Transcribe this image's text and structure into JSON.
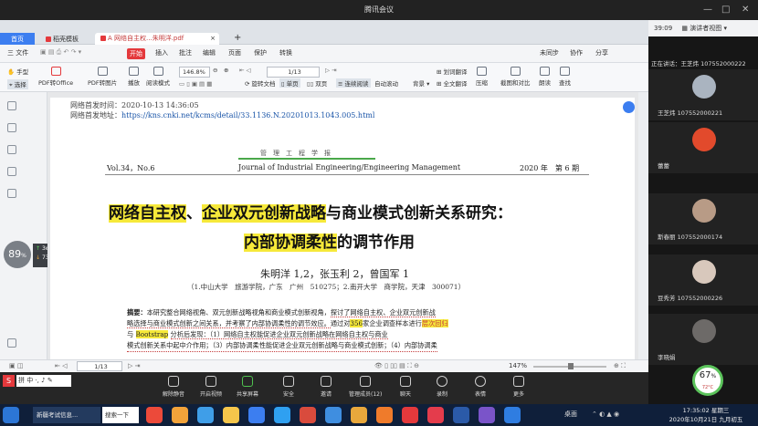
{
  "window": {
    "title": "腾讯会议"
  },
  "tabs": {
    "home": "首页",
    "tab1": "稻壳模板",
    "tab2": "A 网络自主权...朱明洋.pdf",
    "add": "+"
  },
  "menubar": {
    "file": "三 文件",
    "start": "开始",
    "insert": "插入",
    "annotate": "批注",
    "edit": "编辑",
    "page": "页面",
    "protect": "保护",
    "convert": "转换",
    "sync": "未同步",
    "collab": "协作",
    "share": "分享"
  },
  "toolbar": {
    "hand": "手型",
    "select": "选择",
    "pdf_office": "PDF转Office",
    "pdf_img": "PDF转图片",
    "play": "播放",
    "read": "阅读模式",
    "zoom": "146.8%",
    "page_cur": "1",
    "page_total": "/13",
    "rotate": "旋转文档",
    "single": "单页",
    "double": "双页",
    "continuous": "连续阅读",
    "auto_scroll": "自动滚动",
    "bg": "背景",
    "translate": "全文翻译",
    "compress": "压缩",
    "ocr": "截图和对比",
    "read_aloud": "朗读",
    "find": "查找",
    "word_translate": "划词翻译"
  },
  "document": {
    "meta_time": "网络首发时间：2020-10-13 14:36:05",
    "meta_addr_label": "网络首发地址：",
    "meta_addr_url": "https://kns.cnki.net/kcms/detail/33.1136.N.20201013.1043.005.html",
    "journal_cn": "管　理　工　程　学　报",
    "vol": "Vol.34，No.6",
    "journal_en": "Journal of Industrial Engineering/Engineering Management",
    "year": "2020 年　第 6 期",
    "title_hl1": "网络自主权",
    "title_sep": "、",
    "title_hl2": "企业双元创新战略",
    "title_rest": "与商业模式创新关系研究：",
    "title2_hl": "内部协调柔性",
    "title2_rest": "的调节作用",
    "authors": "朱明洋 1,2，张玉利 2，曾国军 1",
    "affil": "（1.中山大学　旅游学院，广东　广州　510275；2.南开大学　商学院，天津　300071）",
    "abs_label": "摘要：",
    "abs_l1a": "本研究整合网络视角、双元创新战略视角和商业模式创新视角，",
    "abs_l1b": "探讨了网络自主权、企业双元创新战",
    "abs_l2a": "略选择与商业模式创新之间关系，并考察了内部协调柔性的调节效应。",
    "abs_l2b": "通过对",
    "abs_num": "356",
    "abs_l2c": "家企业调查样本进行",
    "abs_l2d": "层次回归",
    "abs_l3a": "与",
    "abs_boot": "Bootstrap",
    "abs_l3b": "分析后发现：（1）网络自主权能促进企业双元创新战略在网络自主权与商业",
    "abs_l4": "模式创新关系中起中介作用；（3）内部协调柔性能促进企业双元创新战略与商业模式创新；（4）内部协调柔"
  },
  "status": {
    "page": "1",
    "total": "/13",
    "zoom": "147%"
  },
  "meeting": {
    "mute": "解除静音",
    "video": "开启视频",
    "share": "共享屏幕",
    "security": "安全",
    "invite": "邀请",
    "members": "管理成员(12)",
    "chat": "聊天",
    "record": "录制",
    "reactions": "表情",
    "more": "更多",
    "end": "结束会议"
  },
  "right": {
    "time": "39:09",
    "view": "演讲者视图",
    "speaking": "正在讲话：王芝炜 107552000222",
    "p1": "王芝炜 107552000221",
    "p2": "蕾蕾",
    "p3": "斯春丽 107552000174",
    "p4": "豆秀芳 107552000226",
    "p5": "李晓娟"
  },
  "gauges": {
    "cpu": "89",
    "cpu_unit": "%",
    "up": "3",
    "up_unit": "K/s",
    "down": "73",
    "down_unit": "K/s",
    "mem": "67",
    "mem_unit": "%",
    "temp": "72°C"
  },
  "taskbar": {
    "item1": "新疆考试信息...",
    "item2": "搜索一下",
    "clock": "17:35:02 星期三",
    "date": "2020年10月21日 九月初五",
    "desktop": "桌面"
  },
  "input": {
    "lang": "中"
  }
}
